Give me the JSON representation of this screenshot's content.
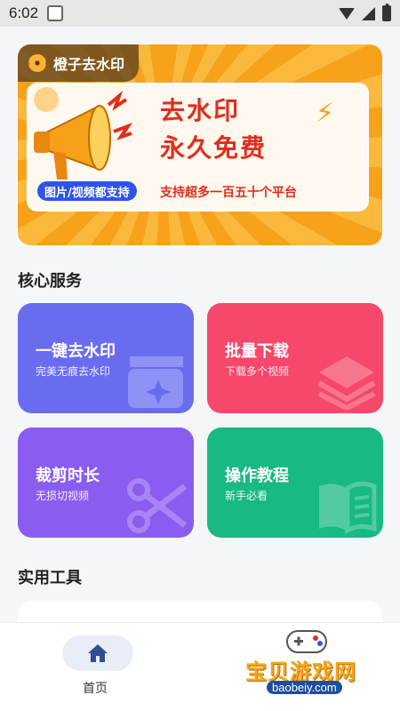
{
  "status_bar": {
    "time": "6:02"
  },
  "banner": {
    "tag": "橙子去水印",
    "headline_line1": "去水印",
    "headline_line2": "永久免费",
    "pill": "图片/视频都支持",
    "subtitle": "支持超多一百五十个平台"
  },
  "core_services": {
    "title": "核心服务",
    "cards": [
      {
        "title": "一键去水印",
        "subtitle": "完美无痕去水印",
        "color": "#6a6cf0",
        "icon": "clapper-sparkle-icon"
      },
      {
        "title": "批量下载",
        "subtitle": "下载多个视频",
        "color": "#f5486a",
        "icon": "layers-icon"
      },
      {
        "title": "裁剪时长",
        "subtitle": "无损切视频",
        "color": "#8a5cf0",
        "icon": "scissors-icon"
      },
      {
        "title": "操作教程",
        "subtitle": "新手必看",
        "color": "#18b983",
        "icon": "book-icon"
      }
    ]
  },
  "tools": {
    "title": "实用工具"
  },
  "bottom_nav": {
    "home_label": "首页",
    "home_icon": "home-icon"
  },
  "watermark": {
    "text": "宝贝游戏网",
    "url": "baobeiy.com"
  }
}
